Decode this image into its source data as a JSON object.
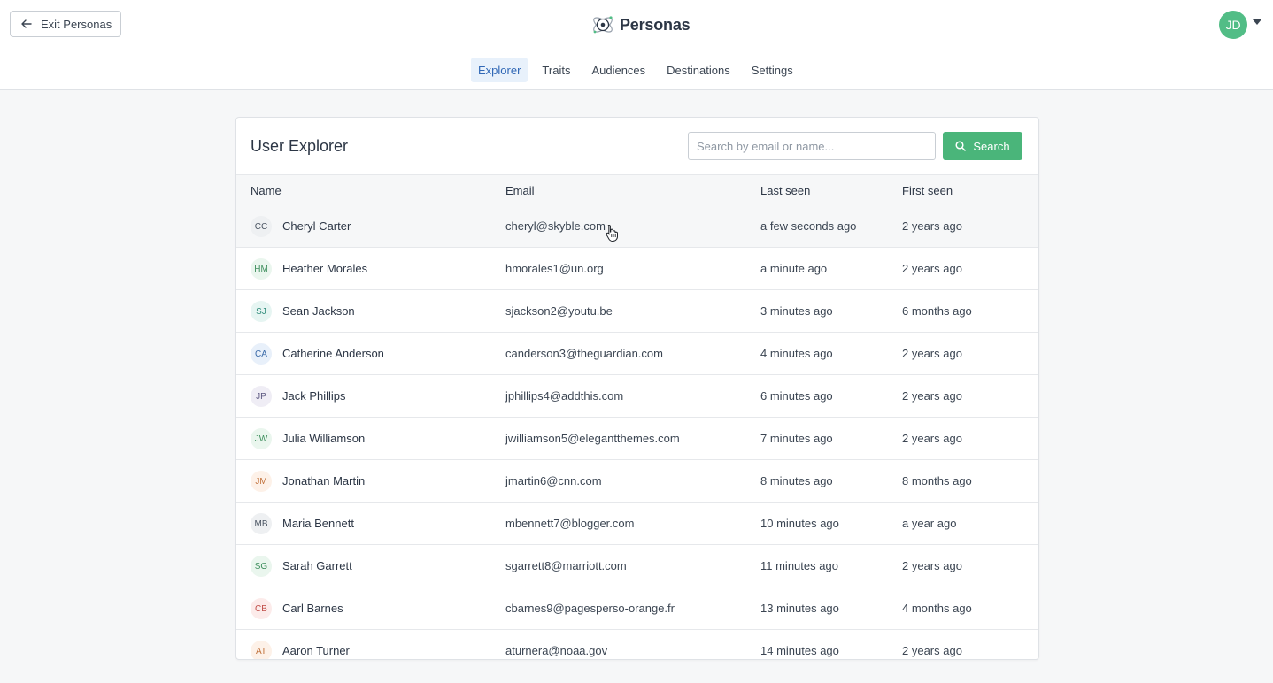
{
  "header": {
    "exit_label": "Exit Personas",
    "brand_name": "Personas",
    "user_initials": "JD",
    "user_color": "#52bd86"
  },
  "nav": {
    "tabs": [
      {
        "label": "Explorer",
        "active": true
      },
      {
        "label": "Traits"
      },
      {
        "label": "Audiences"
      },
      {
        "label": "Destinations"
      },
      {
        "label": "Settings"
      }
    ]
  },
  "explorer": {
    "title": "User Explorer",
    "search_placeholder": "Search by email or name...",
    "search_button": "Search",
    "columns": [
      "Name",
      "Email",
      "Last seen",
      "First seen"
    ],
    "rows": [
      {
        "initials": "CC",
        "name": "Cheryl Carter",
        "email": "cheryl@skyble.com",
        "last_seen": "a few seconds ago",
        "first_seen": "2 years ago",
        "avatar_bg": "#eef0f2",
        "avatar_fg": "#4b5563"
      },
      {
        "initials": "HM",
        "name": "Heather Morales",
        "email": "hmorales1@un.org",
        "last_seen": "a minute ago",
        "first_seen": "2 years ago",
        "avatar_bg": "#eaf6ee",
        "avatar_fg": "#3f8f5e"
      },
      {
        "initials": "SJ",
        "name": "Sean Jackson",
        "email": "sjackson2@youtu.be",
        "last_seen": "3 minutes ago",
        "first_seen": "6 months ago",
        "avatar_bg": "#e6f5f2",
        "avatar_fg": "#2f8b7a"
      },
      {
        "initials": "CA",
        "name": "Catherine Anderson",
        "email": "canderson3@theguardian.com",
        "last_seen": "4 minutes ago",
        "first_seen": "2 years ago",
        "avatar_bg": "#e8f0fa",
        "avatar_fg": "#3a6aa8"
      },
      {
        "initials": "JP",
        "name": "Jack Phillips",
        "email": "jphillips4@addthis.com",
        "last_seen": "6 minutes ago",
        "first_seen": "2 years ago",
        "avatar_bg": "#efedf5",
        "avatar_fg": "#5b5780"
      },
      {
        "initials": "JW",
        "name": "Julia Williamson",
        "email": "jwilliamson5@elegantthemes.com",
        "last_seen": "7 minutes ago",
        "first_seen": "2 years ago",
        "avatar_bg": "#eaf6ee",
        "avatar_fg": "#3f8f5e"
      },
      {
        "initials": "JM",
        "name": "Jonathan Martin",
        "email": "jmartin6@cnn.com",
        "last_seen": "8 minutes ago",
        "first_seen": "8 months ago",
        "avatar_bg": "#fdf1e8",
        "avatar_fg": "#c0703a"
      },
      {
        "initials": "MB",
        "name": "Maria Bennett",
        "email": "mbennett7@blogger.com",
        "last_seen": "10 minutes ago",
        "first_seen": "a year ago",
        "avatar_bg": "#eef0f2",
        "avatar_fg": "#4b5563"
      },
      {
        "initials": "SG",
        "name": "Sarah Garrett",
        "email": "sgarrett8@marriott.com",
        "last_seen": "11 minutes ago",
        "first_seen": "2 years ago",
        "avatar_bg": "#eaf6ee",
        "avatar_fg": "#3f8f5e"
      },
      {
        "initials": "CB",
        "name": "Carl Barnes",
        "email": "cbarnes9@pagesperso-orange.fr",
        "last_seen": "13 minutes ago",
        "first_seen": "4 months ago",
        "avatar_bg": "#fcebea",
        "avatar_fg": "#bf4b46"
      },
      {
        "initials": "AT",
        "name": "Aaron Turner",
        "email": "aturnera@noaa.gov",
        "last_seen": "14 minutes ago",
        "first_seen": "2 years ago",
        "avatar_bg": "#fdf1e8",
        "avatar_fg": "#c0703a"
      }
    ]
  },
  "colors": {
    "accent_green": "#4ab57a",
    "active_tab_bg": "#e8f1fb",
    "active_tab_text": "#3168b6"
  }
}
